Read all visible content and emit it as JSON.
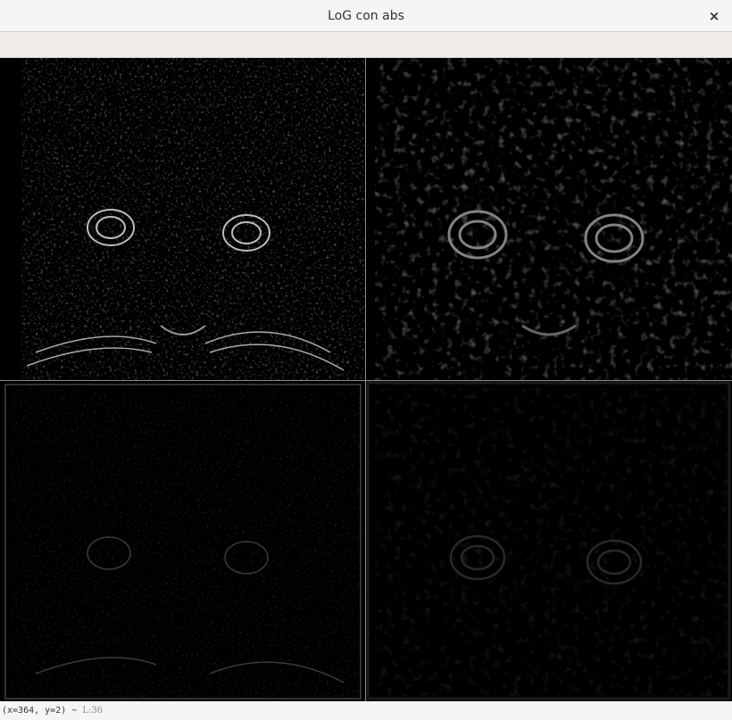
{
  "window": {
    "title": "LoG con abs",
    "close_glyph": "×"
  },
  "status": {
    "coords": "(x=364, y=2) ~ ",
    "pixel_value": "L:36"
  },
  "panels": [
    {
      "name": "log-panel-top-left",
      "brightness": 0.9
    },
    {
      "name": "log-panel-top-right",
      "brightness": 0.75
    },
    {
      "name": "log-panel-bottom-left",
      "brightness": 0.45
    },
    {
      "name": "log-panel-bottom-right",
      "brightness": 0.35
    }
  ]
}
